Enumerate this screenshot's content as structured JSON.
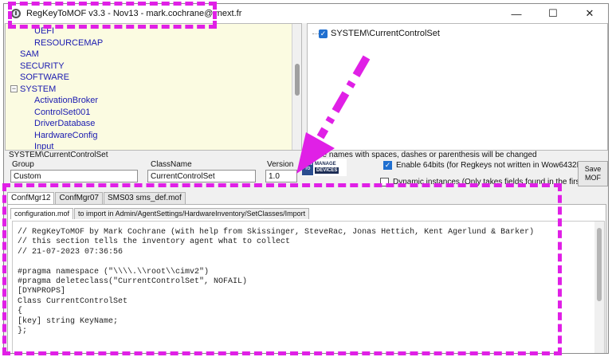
{
  "window": {
    "title": "RegKeyToMOF v3.3 - Nov13 - mark.cochrane@vnext.fr",
    "min_glyph": "—",
    "max_glyph": "☐",
    "close_glyph": "✕"
  },
  "tree": {
    "items": [
      {
        "label": "UEFI",
        "level": 2
      },
      {
        "label": "RESOURCEMAP",
        "level": 2
      },
      {
        "label": "SAM",
        "level": 1
      },
      {
        "label": "SECURITY",
        "level": 1
      },
      {
        "label": "SOFTWARE",
        "level": 1
      },
      {
        "label": "SYSTEM",
        "level": 1,
        "expander": "−"
      },
      {
        "label": "ActivationBroker",
        "level": 2
      },
      {
        "label": "ControlSet001",
        "level": 2
      },
      {
        "label": "DriverDatabase",
        "level": 2
      },
      {
        "label": "HardwareConfig",
        "level": 2
      },
      {
        "label": "Input",
        "level": 2
      }
    ]
  },
  "right_tree": {
    "node_label": "SYSTEM\\CurrentControlSet",
    "check_glyph": "✓"
  },
  "form": {
    "selected_path": "SYSTEM\\CurrentControlSet",
    "group_label": "Group",
    "group_value": "Custom",
    "classname_label": "ClassName",
    "classname_value": "CurrentControlSet",
    "version_label": "Version",
    "version_value": "1.0",
    "note": "de names with spaces, dashes or parenthesis will be changed",
    "enable64_label": "Enable 64bits (for Regkeys not written in Wow6432Node)",
    "enable64_checked": true,
    "dynamic_label": "Dynamic instances (Only takes fields found in the first child)",
    "dynamic_checked": false,
    "save_label_1": "Save",
    "save_label_2": "MOF",
    "check_glyph": "✓"
  },
  "logo": {
    "how": "HOW TO",
    "manage": "MANAGE",
    "devices": "DEVICES"
  },
  "outer_tabs": [
    "ConfMgr12",
    "ConfMgr07",
    "SMS03 sms_def.mof"
  ],
  "inner_tabs": [
    "configuration.mof",
    "to import in Admin/AgentSettings/HardwareInventory/SetClasses/Import"
  ],
  "code_lines": [
    "// RegKeyToMOF by Mark Cochrane (with help from Skissinger, SteveRac, Jonas Hettich, Kent Agerlund & Barker)",
    "// this section tells the inventory agent what to collect",
    "// 21-07-2023 07:36:56",
    "",
    "#pragma namespace (\"\\\\\\\\.\\\\root\\\\cimv2\")",
    "#pragma deleteclass(\"CurrentControlSet\", NOFAIL)",
    "[DYNPROPS]",
    "Class CurrentControlSet",
    "{",
    "[key] string KeyName;",
    "};"
  ],
  "colors": {
    "highlight": "#e020e6",
    "tree_bg": "#fbfbe1",
    "tree_text": "#1a1ab0",
    "accent": "#1f6fd0"
  }
}
